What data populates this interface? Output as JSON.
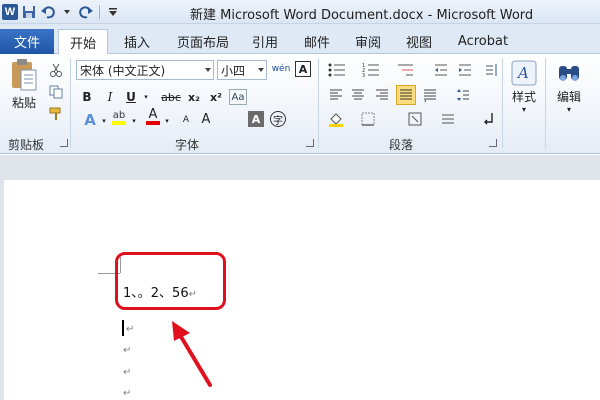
{
  "window": {
    "title": "新建 Microsoft Word Document.docx - Microsoft Word"
  },
  "quick_access": {
    "logo_text": "W",
    "icons": [
      "word-logo-icon",
      "save-icon",
      "undo-icon",
      "redo-icon",
      "customize-icon"
    ]
  },
  "tabs": {
    "file": "文件",
    "items": [
      "开始",
      "插入",
      "页面布局",
      "引用",
      "邮件",
      "审阅",
      "视图",
      "Acrobat"
    ],
    "active": "开始"
  },
  "ribbon": {
    "clipboard": {
      "paste_label": "粘贴",
      "group_label": "剪贴板"
    },
    "font": {
      "font_name": "宋体 (中文正文)",
      "font_size": "小四",
      "phonetic_label": "wén",
      "border_char": "A",
      "bold": "B",
      "italic": "I",
      "underline": "U",
      "strike": "abc",
      "subscript": "x₂",
      "superscript": "x²",
      "grow": "A",
      "shrink": "A",
      "case": "Aa",
      "shade_char": "A",
      "enclose_char": "字",
      "highlight_char": "ab",
      "font_color_char": "A",
      "group_label": "字体",
      "highlight_color": "#ffff00",
      "font_color": "#e00000"
    },
    "paragraph": {
      "group_label": "段落"
    },
    "styles": {
      "label": "样式"
    },
    "editing": {
      "label": "编辑"
    }
  },
  "document": {
    "line1": "1、。2、56",
    "paragraph_mark": "↵"
  },
  "annotation": {
    "color": "#e0101e"
  }
}
